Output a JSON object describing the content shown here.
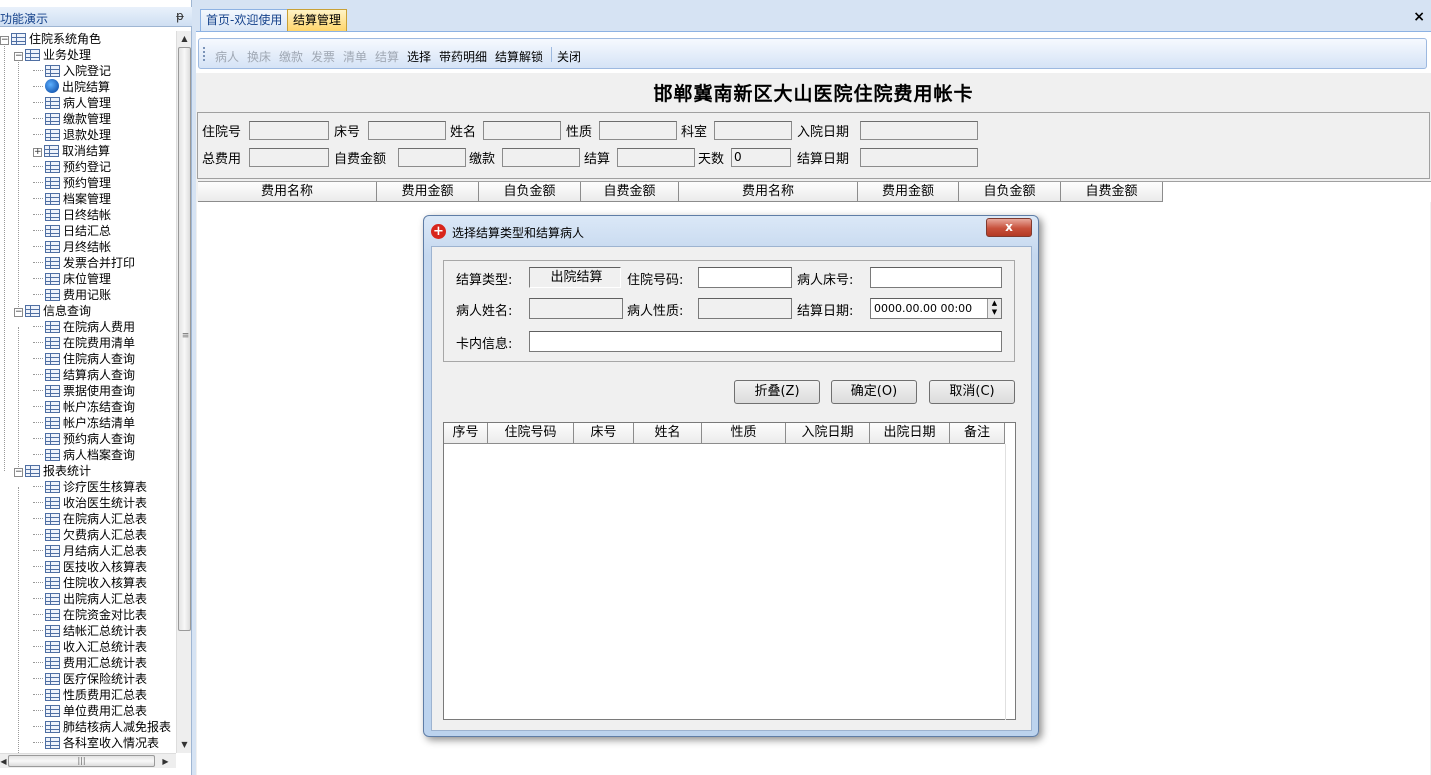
{
  "left_panel": {
    "title": "功能演示",
    "pin_icon": "pin-icon",
    "tree": [
      {
        "label": "住院系统角色",
        "level": 0,
        "expander": "-"
      },
      {
        "label": "业务处理",
        "level": 1,
        "expander": "-"
      },
      {
        "label": "入院登记",
        "level": 2
      },
      {
        "label": "出院结算",
        "level": 2,
        "icon": "exit-icon"
      },
      {
        "label": "病人管理",
        "level": 2
      },
      {
        "label": "缴款管理",
        "level": 2
      },
      {
        "label": "退款处理",
        "level": 2
      },
      {
        "label": "取消结算",
        "level": 2,
        "expander": "+"
      },
      {
        "label": "预约登记",
        "level": 2
      },
      {
        "label": "预约管理",
        "level": 2
      },
      {
        "label": "档案管理",
        "level": 2
      },
      {
        "label": "日终结帐",
        "level": 2
      },
      {
        "label": "日结汇总",
        "level": 2
      },
      {
        "label": "月终结帐",
        "level": 2
      },
      {
        "label": "发票合并打印",
        "level": 2
      },
      {
        "label": "床位管理",
        "level": 2
      },
      {
        "label": "费用记账",
        "level": 2
      },
      {
        "label": "信息查询",
        "level": 1,
        "expander": "-"
      },
      {
        "label": "在院病人费用",
        "level": 2
      },
      {
        "label": "在院费用清单",
        "level": 2
      },
      {
        "label": "住院病人查询",
        "level": 2
      },
      {
        "label": "结算病人查询",
        "level": 2
      },
      {
        "label": "票据使用查询",
        "level": 2
      },
      {
        "label": "帐户冻结查询",
        "level": 2
      },
      {
        "label": "帐户冻结清单",
        "level": 2
      },
      {
        "label": "预约病人查询",
        "level": 2
      },
      {
        "label": "病人档案查询",
        "level": 2
      },
      {
        "label": "报表统计",
        "level": 1,
        "expander": "-"
      },
      {
        "label": "诊疗医生核算表",
        "level": 2
      },
      {
        "label": "收治医生统计表",
        "level": 2
      },
      {
        "label": "在院病人汇总表",
        "level": 2
      },
      {
        "label": "欠费病人汇总表",
        "level": 2
      },
      {
        "label": "月结病人汇总表",
        "level": 2
      },
      {
        "label": "医技收入核算表",
        "level": 2
      },
      {
        "label": "住院收入核算表",
        "level": 2
      },
      {
        "label": "出院病人汇总表",
        "level": 2
      },
      {
        "label": "在院资金对比表",
        "level": 2
      },
      {
        "label": "结帐汇总统计表",
        "level": 2
      },
      {
        "label": "收入汇总统计表",
        "level": 2
      },
      {
        "label": "费用汇总统计表",
        "level": 2
      },
      {
        "label": "医疗保险统计表",
        "level": 2
      },
      {
        "label": "性质费用汇总表",
        "level": 2
      },
      {
        "label": "单位费用汇总表",
        "level": 2
      },
      {
        "label": "肺结核病人减免报表",
        "level": 2
      },
      {
        "label": "各科室收入情况表",
        "level": 2
      }
    ]
  },
  "tabs": [
    {
      "label": "首页-欢迎使用",
      "active": false
    },
    {
      "label": "结算管理",
      "active": true
    }
  ],
  "tab_close": "×",
  "toolbar": {
    "buttons": [
      {
        "label": "病人",
        "enabled": false
      },
      {
        "label": "换床",
        "enabled": false
      },
      {
        "label": "缴款",
        "enabled": false
      },
      {
        "label": "发票",
        "enabled": false
      },
      {
        "label": "清单",
        "enabled": false
      },
      {
        "label": "结算",
        "enabled": false
      },
      {
        "label": "选择",
        "enabled": true
      },
      {
        "label": "带药明细",
        "enabled": true
      },
      {
        "label": "结算解锁",
        "enabled": true
      },
      {
        "label": "关闭",
        "enabled": true
      }
    ]
  },
  "card": {
    "title": "邯郸冀南新区大山医院住院费用帐卡",
    "fields": {
      "admission_no": {
        "label": "住院号",
        "value": ""
      },
      "bed_no": {
        "label": "床号",
        "value": ""
      },
      "name": {
        "label": "姓名",
        "value": ""
      },
      "nature": {
        "label": "性质",
        "value": ""
      },
      "department": {
        "label": "科室",
        "value": ""
      },
      "admission_date": {
        "label": "入院日期",
        "value": ""
      },
      "total_fee": {
        "label": "总费用",
        "value": ""
      },
      "self_pay_amount": {
        "label": "自费金额",
        "value": ""
      },
      "payment": {
        "label": "缴款",
        "value": ""
      },
      "settlement": {
        "label": "结算",
        "value": ""
      },
      "days": {
        "label": "天数",
        "value": "0"
      },
      "settlement_date": {
        "label": "结算日期",
        "value": ""
      }
    },
    "grid_headers": [
      "费用名称",
      "费用金额",
      "自负金额",
      "自费金额",
      "费用名称",
      "费用金额",
      "自负金额",
      "自费金额"
    ]
  },
  "dialog": {
    "title": "选择结算类型和结算病人",
    "icon": "red-cross-icon",
    "close_label": "x",
    "fields": {
      "settle_type": {
        "label": "结算类型:",
        "value": "出院结算"
      },
      "admission_no": {
        "label": "住院号码:",
        "value": ""
      },
      "bed_no": {
        "label": "病人床号:",
        "value": ""
      },
      "patient_name": {
        "label": "病人姓名:",
        "value": ""
      },
      "patient_nature": {
        "label": "病人性质:",
        "value": ""
      },
      "settle_date": {
        "label": "结算日期:",
        "value": "0000.00.00 00:00"
      },
      "card_info": {
        "label": "卡内信息:",
        "value": ""
      }
    },
    "buttons": {
      "collapse": "折叠(Z)",
      "ok": "确定(O)",
      "cancel": "取消(C)"
    },
    "grid_headers": [
      "序号",
      "住院号码",
      "床号",
      "姓名",
      "性质",
      "入院日期",
      "出院日期",
      "备注"
    ]
  }
}
